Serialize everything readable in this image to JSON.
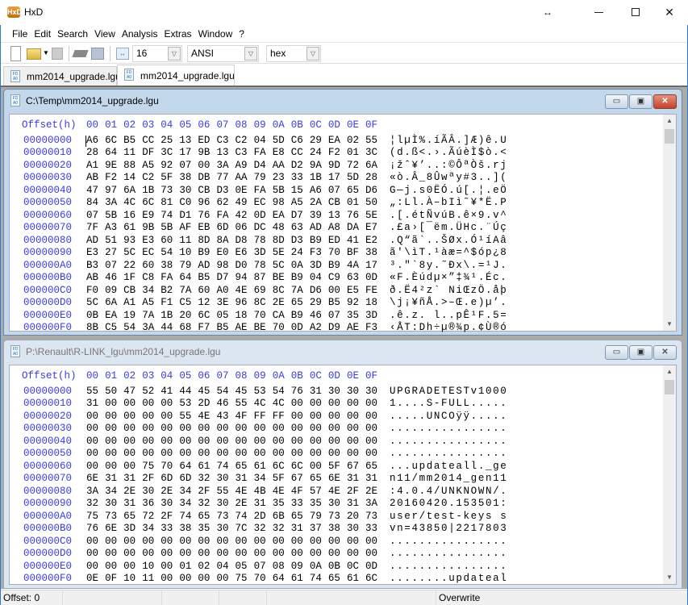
{
  "app": {
    "title": "HxD",
    "icon_label": "HxD"
  },
  "window_controls": {
    "resize_icon": "↔",
    "minimize": "minimize-icon",
    "maximize": "maximize-icon",
    "close": "close-icon"
  },
  "menu": [
    "File",
    "Edit",
    "Search",
    "View",
    "Analysis",
    "Extras",
    "Window",
    "?"
  ],
  "toolbar": {
    "bytes_per_row": "16",
    "charset": "ANSI",
    "offset_base": "hex",
    "icons": [
      "new-file-icon",
      "open-file-icon",
      "save-icon",
      "ram-icon",
      "disk-icon",
      "bytes-per-row-icon"
    ]
  },
  "tabs": [
    {
      "label": "mm2014_upgrade.lgu",
      "active": false
    },
    {
      "label": "mm2014_upgrade.lgu",
      "active": true
    }
  ],
  "colors": {
    "offset_text": "#3a3adf",
    "active_title": "#c4d8ec",
    "inactive_title": "#dce6f1",
    "close_button": "#c2442c"
  },
  "editors": [
    {
      "path": "C:\\Temp\\mm2014_upgrade.lgu",
      "active": true,
      "header_label": "Offset(h)",
      "columns": [
        "00",
        "01",
        "02",
        "03",
        "04",
        "05",
        "06",
        "07",
        "08",
        "09",
        "0A",
        "0B",
        "0C",
        "0D",
        "0E",
        "0F"
      ],
      "rows": [
        {
          "offset": "00000000",
          "bytes": "A6 6C B5 CC 25 13 ED C3 C2 04 5D C6 29 EA 02 55",
          "ascii": "¦lµÌ%.íÃÂ.]Æ)ê.U"
        },
        {
          "offset": "00000010",
          "bytes": "28 64 11 DF 3C 17 9B 13 C3 FA E8 CC 24 F2 01 3C",
          "ascii": "(d.ß<.›.ÃúèÌ$ò.<"
        },
        {
          "offset": "00000020",
          "bytes": "A1 9E 88 A5 92 07 00 3A A9 D4 AA D2 9A 9D 72 6A",
          "ascii": "¡žˆ¥’..:©ÔªÒš.rj"
        },
        {
          "offset": "00000030",
          "bytes": "AB F2 14 C2 5F 38 DB 77 AA 79 23 33 1B 17 5D 28",
          "ascii": "«ò.Â_8Ûwªy#3..]("
        },
        {
          "offset": "00000040",
          "bytes": "47 97 6A 1B 73 30 CB D3 0E FA 5B 15 A6 07 65 D6",
          "ascii": "G—j.s0ËÓ.ú[.¦.eÖ"
        },
        {
          "offset": "00000050",
          "bytes": "84 3A 4C 6C 81 C0 96 62 49 EC 98 A5 2A CB 01 50",
          "ascii": "„:Ll.À–bIì˜¥*Ë.P"
        },
        {
          "offset": "00000060",
          "bytes": "07 5B 16 E9 74 D1 76 FA 42 0D EA D7 39 13 76 5E",
          "ascii": ".[.étÑvúB.ê×9.v^"
        },
        {
          "offset": "00000070",
          "bytes": "7F A3 61 9B 5B AF EB 6D 06 DC 48 63 AD A8 DA E7",
          "ascii": ".£a›[¯ëm.ÜHc.¨Úç"
        },
        {
          "offset": "00000080",
          "bytes": "AD 51 93 E3 60 11 8D 8A D8 78 8D D3 B9 ED 41 E2",
          "ascii": ".Q“ã`..ŠØx.Ó¹íAâ"
        },
        {
          "offset": "00000090",
          "bytes": "E3 27 5C EC 54 10 B9 E0 E6 3D 5E 24 F3 70 BF 38",
          "ascii": "ã'\\ìT.¹àæ=^$óp¿8"
        },
        {
          "offset": "000000A0",
          "bytes": "B3 07 22 60 38 79 AD 98 D0 78 5C 0A 3D B9 4A 17",
          "ascii": "³.\"`8y.˜Ðx\\.=¹J."
        },
        {
          "offset": "000000B0",
          "bytes": "AB 46 1F C8 FA 64 B5 D7 94 87 BE B9 04 C9 63 0D",
          "ascii": "«F.Èúdµ×”‡¾¹.Éc."
        },
        {
          "offset": "000000C0",
          "bytes": "F0 09 CB 34 B2 7A 60 A0 4E 69 8C 7A D6 00 E5 FE",
          "ascii": "ð.Ë4²z` NiŒzÖ.åþ"
        },
        {
          "offset": "000000D0",
          "bytes": "5C 6A A1 A5 F1 C5 12 3E 96 8C 2E 65 29 B5 92 18",
          "ascii": "\\j¡¥ñÅ.>–Œ.e)µ’."
        },
        {
          "offset": "000000E0",
          "bytes": "0B EA 19 7A 1B 20 6C 05 18 70 CA B9 46 07 35 3D",
          "ascii": ".ê.z. l..pÊ¹F.5="
        },
        {
          "offset": "000000F0",
          "bytes": "8B C5 54 3A 44 68 F7 B5 AE BE 70 0D A2 D9 AE F3",
          "ascii": "‹ÅT:Dh÷µ®¾p.¢Ù®ó"
        }
      ]
    },
    {
      "path": "P:\\Renault\\R-LINK_lgu\\mm2014_upgrade.lgu",
      "active": false,
      "header_label": "Offset(h)",
      "columns": [
        "00",
        "01",
        "02",
        "03",
        "04",
        "05",
        "06",
        "07",
        "08",
        "09",
        "0A",
        "0B",
        "0C",
        "0D",
        "0E",
        "0F"
      ],
      "rows": [
        {
          "offset": "00000000",
          "bytes": "55 50 47 52 41 44 45 54 45 53 54 76 31 30 30 30",
          "ascii": "UPGRADETESTv1000"
        },
        {
          "offset": "00000010",
          "bytes": "31 00 00 00 00 53 2D 46 55 4C 4C 00 00 00 00 00",
          "ascii": "1....S-FULL....."
        },
        {
          "offset": "00000020",
          "bytes": "00 00 00 00 00 55 4E 43 4F FF FF 00 00 00 00 00",
          "ascii": ".....UNCOÿÿ....."
        },
        {
          "offset": "00000030",
          "bytes": "00 00 00 00 00 00 00 00 00 00 00 00 00 00 00 00",
          "ascii": "................"
        },
        {
          "offset": "00000040",
          "bytes": "00 00 00 00 00 00 00 00 00 00 00 00 00 00 00 00",
          "ascii": "................"
        },
        {
          "offset": "00000050",
          "bytes": "00 00 00 00 00 00 00 00 00 00 00 00 00 00 00 00",
          "ascii": "................"
        },
        {
          "offset": "00000060",
          "bytes": "00 00 00 75 70 64 61 74 65 61 6C 6C 00 5F 67 65",
          "ascii": "...updateall._ge"
        },
        {
          "offset": "00000070",
          "bytes": "6E 31 31 2F 6D 6D 32 30 31 34 5F 67 65 6E 31 31",
          "ascii": "n11/mm2014_gen11"
        },
        {
          "offset": "00000080",
          "bytes": "3A 34 2E 30 2E 34 2F 55 4E 4B 4E 4F 57 4E 2F 2E",
          "ascii": ":4.0.4/UNKNOWN/."
        },
        {
          "offset": "00000090",
          "bytes": "32 30 31 36 30 34 32 30 2E 31 35 33 35 30 31 3A",
          "ascii": "20160420.153501:"
        },
        {
          "offset": "000000A0",
          "bytes": "75 73 65 72 2F 74 65 73 74 2D 6B 65 79 73 20 73",
          "ascii": "user/test-keys s"
        },
        {
          "offset": "000000B0",
          "bytes": "76 6E 3D 34 33 38 35 30 7C 32 32 31 37 38 30 33",
          "ascii": "vn=43850|2217803"
        },
        {
          "offset": "000000C0",
          "bytes": "00 00 00 00 00 00 00 00 00 00 00 00 00 00 00 00",
          "ascii": "................"
        },
        {
          "offset": "000000D0",
          "bytes": "00 00 00 00 00 00 00 00 00 00 00 00 00 00 00 00",
          "ascii": "................"
        },
        {
          "offset": "000000E0",
          "bytes": "00 00 00 10 00 01 02 04 05 07 08 09 0A 0B 0C 0D",
          "ascii": "................"
        },
        {
          "offset": "000000F0",
          "bytes": "0E 0F 10 11 00 00 00 00 75 70 64 61 74 65 61 6C",
          "ascii": "........updateal"
        }
      ]
    }
  ],
  "status": {
    "offset": "Offset: 0",
    "mode": "Overwrite"
  }
}
